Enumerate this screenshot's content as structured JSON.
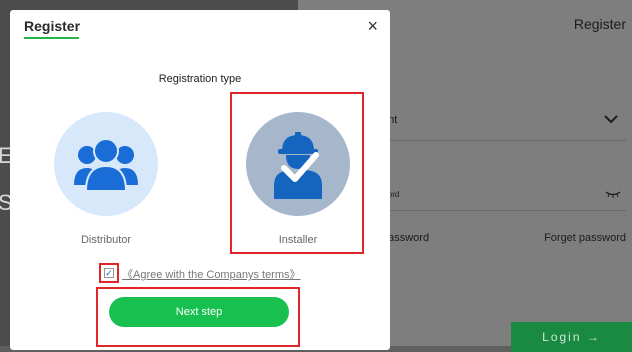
{
  "background": {
    "left_big_1": "E",
    "left_big_2": "S",
    "register_title": "Register",
    "account_label": "unt",
    "password_label": "word",
    "remember_label": "password",
    "forget_password": "Forget password",
    "login_label": "Login →"
  },
  "modal": {
    "title": "Register",
    "close_symbol": "×",
    "registration_type": "Registration type",
    "options": [
      {
        "label": "Distributor",
        "icon": "group-icon",
        "selected": false
      },
      {
        "label": "Installer",
        "icon": "installer-worker-icon",
        "selected": true
      }
    ],
    "agree_text": "《Agree with the Companys terms》",
    "agree_checked": true,
    "next_step": "Next step"
  },
  "colors": {
    "accent_green": "#17c04f",
    "highlight_red": "#e1262b",
    "distributor_bg": "#d8e8fb",
    "distributor_icon": "#1a6cd6",
    "installer_bg": "#a6b7cc",
    "installer_icon": "#1565c0"
  }
}
